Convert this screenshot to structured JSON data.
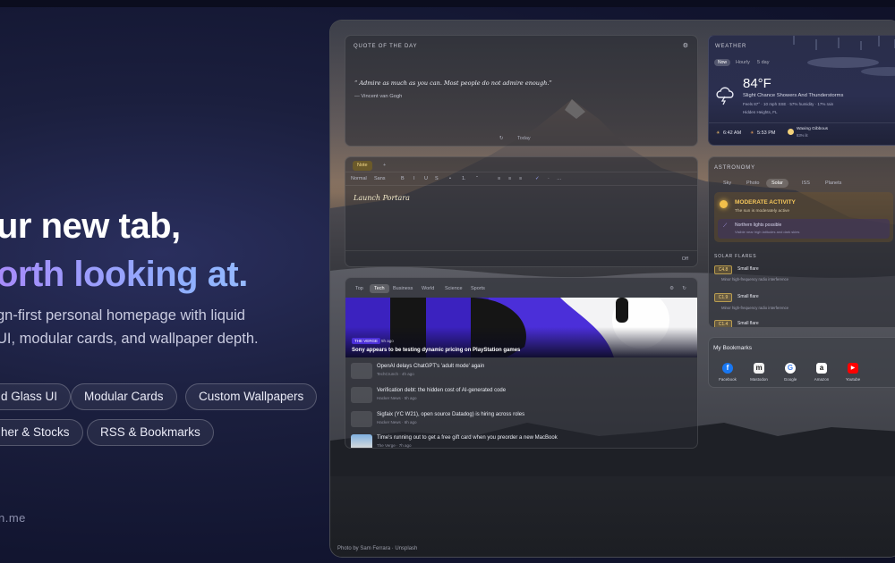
{
  "hero": {
    "title_line1": "ur new tab,",
    "title_line2": "orth looking at.",
    "subtitle_line1": "gn-first personal homepage with liquid",
    "subtitle_line2": "UI, modular cards, and wallpaper depth."
  },
  "pills": [
    "d Glass UI",
    "Modular Cards",
    "Custom Wallpapers",
    "her & Stocks",
    "RSS & Bookmarks"
  ],
  "site": "n.me",
  "quote": {
    "label": "QUOTE OF THE DAY",
    "text": "“ Admire as much as you can. Most people do not admire enough.”",
    "author": "— Vincent van Gogh",
    "footer": "Today"
  },
  "notes": {
    "tab": "Note",
    "add": "+",
    "toolbar": [
      "Normal",
      "Sans",
      "B",
      "I",
      "U",
      "S",
      "•",
      "1.",
      "“",
      "≡",
      "≡",
      "≡",
      "✓",
      "·",
      "…"
    ],
    "title": "Launch Portara",
    "footer": "Off"
  },
  "news": {
    "tabs": [
      "Top",
      "Tech",
      "Business",
      "World",
      "Science",
      "Sports"
    ],
    "active_tab": "Tech",
    "hero": {
      "source": "THE VERGE",
      "time": "5h ago",
      "title": "Sony appears to be testing dynamic pricing on PlayStation games"
    },
    "items": [
      {
        "title": "OpenAI delays ChatGPT's 'adult mode' again",
        "meta": "TechCrunch · 4h ago"
      },
      {
        "title": "Verification debt: the hidden cost of AI-generated code",
        "meta": "Hacker News · 5h ago"
      },
      {
        "title": "Sigfaix (YC W21), open source Datadog) is hiring across roles",
        "meta": "Hacker News · 6h ago"
      },
      {
        "title": "Time's running out to get a free gift card when you preorder a new MacBook",
        "meta": "The Verge · 7h ago"
      }
    ]
  },
  "weather": {
    "label": "WEATHER",
    "tabs": [
      "Now",
      "Hourly",
      "5 day"
    ],
    "temp": "84°F",
    "desc": "Slight Chance Showers And Thunderstorms",
    "details": "Feels 87°  ·  10 mph SSE  ·  57% humidity  ·  17% rain",
    "location": "Hidden Heights, FL",
    "sunrise": "6:42 AM",
    "sunset": "5:53 PM",
    "moon": "Waxing Gibbous",
    "moon_pct": "83% lit"
  },
  "astronomy": {
    "label": "ASTRONOMY",
    "chips": [
      "Sky",
      "Photo",
      "Solar",
      "ISS",
      "Planets"
    ],
    "active_chip": "Solar",
    "activity_title": "MODERATE ACTIVITY",
    "activity_sub": "The sun is moderately active",
    "aurora": "Northern lights possible",
    "aurora_sub": "Visible near high latitudes and dark skies",
    "flares_label": "SOLAR FLARES",
    "flares": [
      {
        "class": "C4.8",
        "name": "Small flare",
        "desc": "Minor high-frequency radio interference"
      },
      {
        "class": "C1.9",
        "name": "Small flare",
        "desc": "Minor high-frequency radio interference"
      },
      {
        "class": "C1.4",
        "name": "Small flare",
        "desc": ""
      }
    ]
  },
  "bookmarks": {
    "label": "My Bookmarks",
    "items": [
      {
        "name": "Facebook",
        "glyph": "f",
        "color": "#1877f2"
      },
      {
        "name": "Mastodon",
        "glyph": "m",
        "color": "#3a3a3a"
      },
      {
        "name": "Google",
        "glyph": "G",
        "color": "#ffffff"
      },
      {
        "name": "Amazon",
        "glyph": "a",
        "color": "#ffffff"
      },
      {
        "name": "Youtube",
        "glyph": "▶",
        "color": "#ff0000"
      }
    ]
  },
  "photo_credit": "Photo by Sam Ferrara · Unsplash"
}
